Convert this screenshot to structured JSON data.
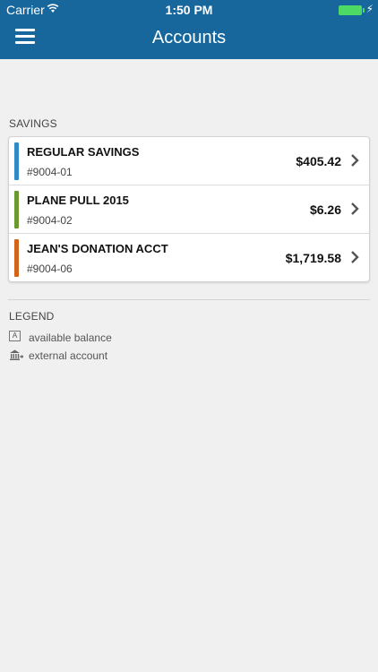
{
  "status_bar": {
    "carrier": "Carrier",
    "time": "1:50 PM"
  },
  "header": {
    "title": "Accounts",
    "icons": [
      "menu-icon"
    ]
  },
  "savings": {
    "section_label": "SAVINGS",
    "accounts": [
      {
        "name": "REGULAR SAVINGS",
        "number": "#9004-01",
        "balance": "$405.42",
        "color": "#2e8bc6"
      },
      {
        "name": "PLANE PULL 2015",
        "number": "#9004-02",
        "balance": "$6.26",
        "color": "#6a9a2e"
      },
      {
        "name": "JEAN'S DONATION ACCT",
        "number": "#9004-06",
        "balance": "$1,719.58",
        "color": "#d4631a"
      }
    ]
  },
  "legend": {
    "label": "LEGEND",
    "items": [
      {
        "icon": "available-balance-icon",
        "glyph": "A",
        "text": "available balance"
      },
      {
        "icon": "external-account-icon",
        "text": "external account"
      }
    ]
  },
  "colors": {
    "header_bg": "#17679d",
    "page_bg": "#f0f0f0",
    "battery": "#4cd964"
  }
}
